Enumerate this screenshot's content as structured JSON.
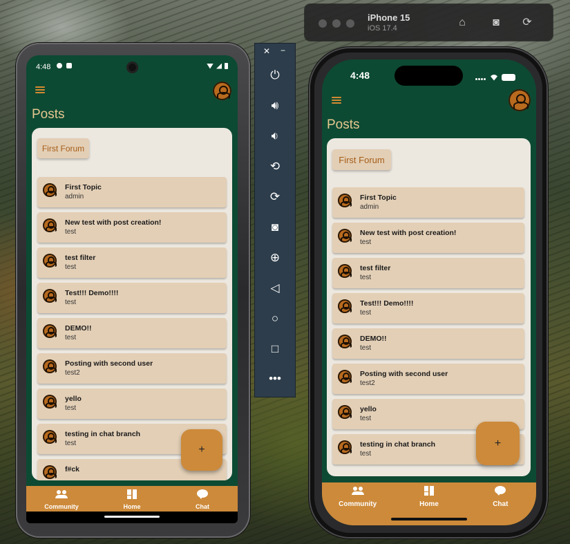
{
  "android": {
    "status": {
      "time": "4:48"
    },
    "page_title": "Posts",
    "forum_chip": "First Forum",
    "posts": [
      {
        "title": "First Topic",
        "author": "admin"
      },
      {
        "title": "New test with post creation!",
        "author": "test"
      },
      {
        "title": "test filter",
        "author": "test"
      },
      {
        "title": "Test!!! Demo!!!!",
        "author": "test"
      },
      {
        "title": "DEMO!!",
        "author": "test"
      },
      {
        "title": "Posting with second user",
        "author": "test2"
      },
      {
        "title": "yello",
        "author": "test"
      },
      {
        "title": "testing in chat branch",
        "author": "test"
      },
      {
        "title": "f#ck",
        "author": ""
      }
    ],
    "fab_label": "+",
    "nav": {
      "community": "Community",
      "home": "Home",
      "chat": "Chat"
    }
  },
  "emulator_toolbar": {
    "close": "✕",
    "minimize": "−",
    "buttons": [
      "power-icon",
      "volume-up-icon",
      "volume-down-icon",
      "rotate-left-icon",
      "rotate-right-icon",
      "camera-icon",
      "zoom-icon",
      "back-icon",
      "home-icon",
      "overview-icon",
      "more-icon"
    ]
  },
  "ios": {
    "device_name": "iPhone 15",
    "os_version": "iOS 17.4",
    "status": {
      "time": "4:48"
    },
    "page_title": "Posts",
    "forum_chip": "First Forum",
    "posts": [
      {
        "title": "First Topic",
        "author": "admin"
      },
      {
        "title": "New test with post creation!",
        "author": "test"
      },
      {
        "title": "test filter",
        "author": "test"
      },
      {
        "title": "Test!!! Demo!!!!",
        "author": "test"
      },
      {
        "title": "DEMO!!",
        "author": "test"
      },
      {
        "title": "Posting with second user",
        "author": "test2"
      },
      {
        "title": "yello",
        "author": "test"
      },
      {
        "title": "testing in chat branch",
        "author": "test"
      }
    ],
    "fab_label": "+",
    "nav": {
      "community": "Community",
      "home": "Home",
      "chat": "Chat"
    }
  },
  "colors": {
    "app_bg": "#0d4a33",
    "accent": "#cd8a3a",
    "post_bg": "#e3cfb6",
    "card_bg": "#ece8e0",
    "title_text": "#e6c890"
  }
}
